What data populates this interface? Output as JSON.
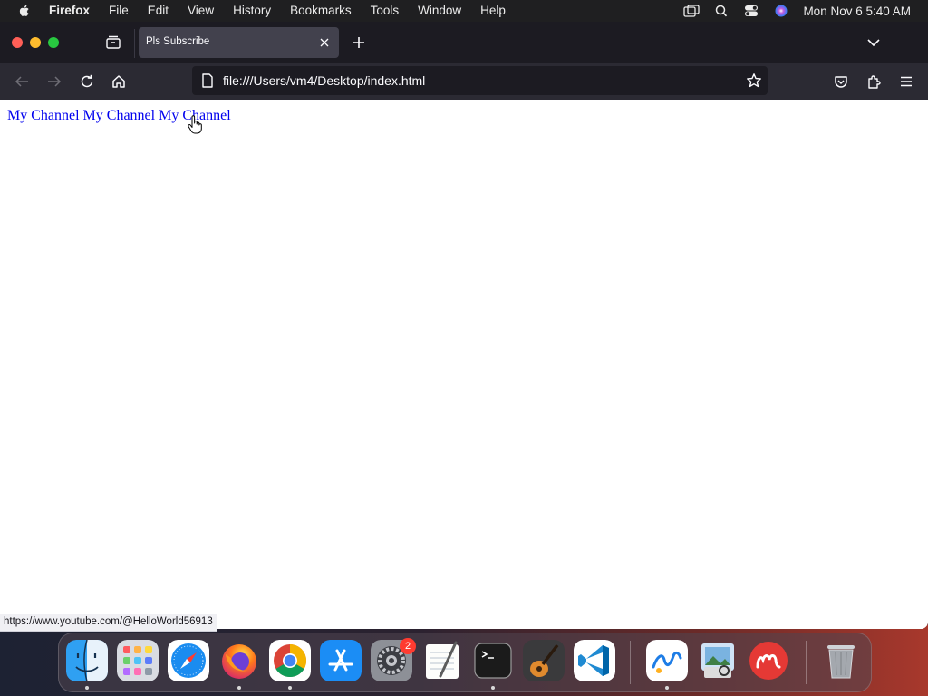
{
  "menubar": {
    "app_name": "Firefox",
    "items": [
      "File",
      "Edit",
      "View",
      "History",
      "Bookmarks",
      "Tools",
      "Window",
      "Help"
    ],
    "clock": "Mon Nov 6  5:40 AM"
  },
  "browser": {
    "tab_title": "Pls Subscribe",
    "url": "file:///Users/vm4/Desktop/index.html"
  },
  "page": {
    "links": [
      "My Channel",
      "My Channel",
      "My Channel"
    ]
  },
  "status_bar": {
    "hover_url": "https://www.youtube.com/@HelloWorld56913"
  },
  "dock": {
    "apps": [
      "Finder",
      "Launchpad",
      "Safari",
      "Firefox",
      "Google Chrome",
      "App Store",
      "System Settings",
      "TextEdit",
      "Terminal",
      "GarageBand",
      "Visual Studio Code",
      "Freeform",
      "Preview",
      "Mendeley",
      "Trash"
    ],
    "settings_badge": "2"
  },
  "colors": {
    "link": "#0000ee",
    "tabbar_bg": "#1c1b22",
    "navbar_bg": "#2b2a33",
    "menubar_bg": "#1f1f21"
  }
}
